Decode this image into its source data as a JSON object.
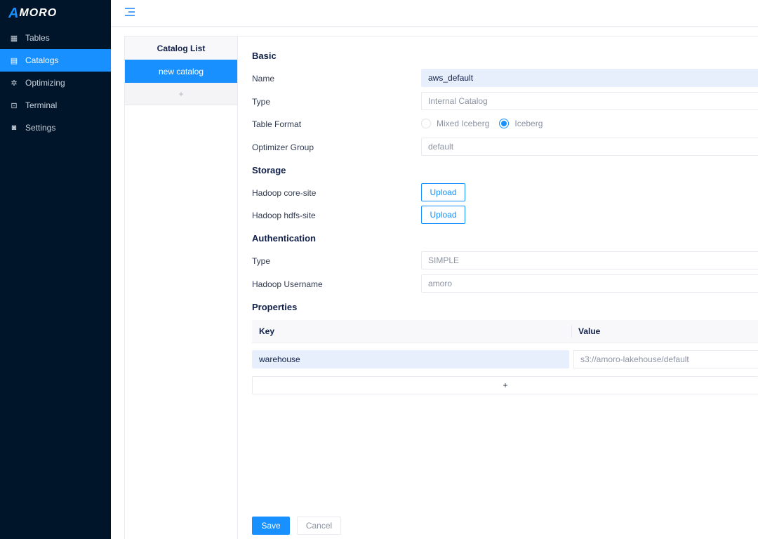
{
  "app": {
    "logo_mark": "A",
    "logo_text": "MORO"
  },
  "sidebar": {
    "items": [
      {
        "label": "Tables",
        "icon": "table-icon",
        "active": false
      },
      {
        "label": "Catalogs",
        "icon": "catalog-icon",
        "active": true
      },
      {
        "label": "Optimizing",
        "icon": "optimizing-icon",
        "active": false
      },
      {
        "label": "Terminal",
        "icon": "terminal-icon",
        "active": false
      },
      {
        "label": "Settings",
        "icon": "settings-icon",
        "active": false
      }
    ]
  },
  "catalog_list": {
    "title": "Catalog List",
    "items": [
      {
        "label": "new catalog",
        "selected": true
      }
    ],
    "add_label": "+"
  },
  "form": {
    "basic": {
      "title": "Basic",
      "name_label": "Name",
      "name_value": "aws_default",
      "type_label": "Type",
      "type_value": "Internal Catalog",
      "table_format_label": "Table Format",
      "table_format_options": [
        "Mixed Iceberg",
        "Iceberg"
      ],
      "table_format_selected": "Iceberg",
      "optimizer_group_label": "Optimizer Group",
      "optimizer_group_value": "default"
    },
    "storage": {
      "title": "Storage",
      "core_site_label": "Hadoop core-site",
      "core_site_button": "Upload",
      "hdfs_site_label": "Hadoop hdfs-site",
      "hdfs_site_button": "Upload"
    },
    "authentication": {
      "title": "Authentication",
      "type_label": "Type",
      "type_value": "SIMPLE",
      "username_label": "Hadoop Username",
      "username_value": "amoro"
    },
    "properties": {
      "title": "Properties",
      "columns": [
        "Key",
        "Value"
      ],
      "rows": [
        {
          "key": "warehouse",
          "value": "s3://amoro-lakehouse/default"
        }
      ],
      "add_label": "+"
    },
    "actions": {
      "save": "Save",
      "cancel": "Cancel"
    }
  }
}
